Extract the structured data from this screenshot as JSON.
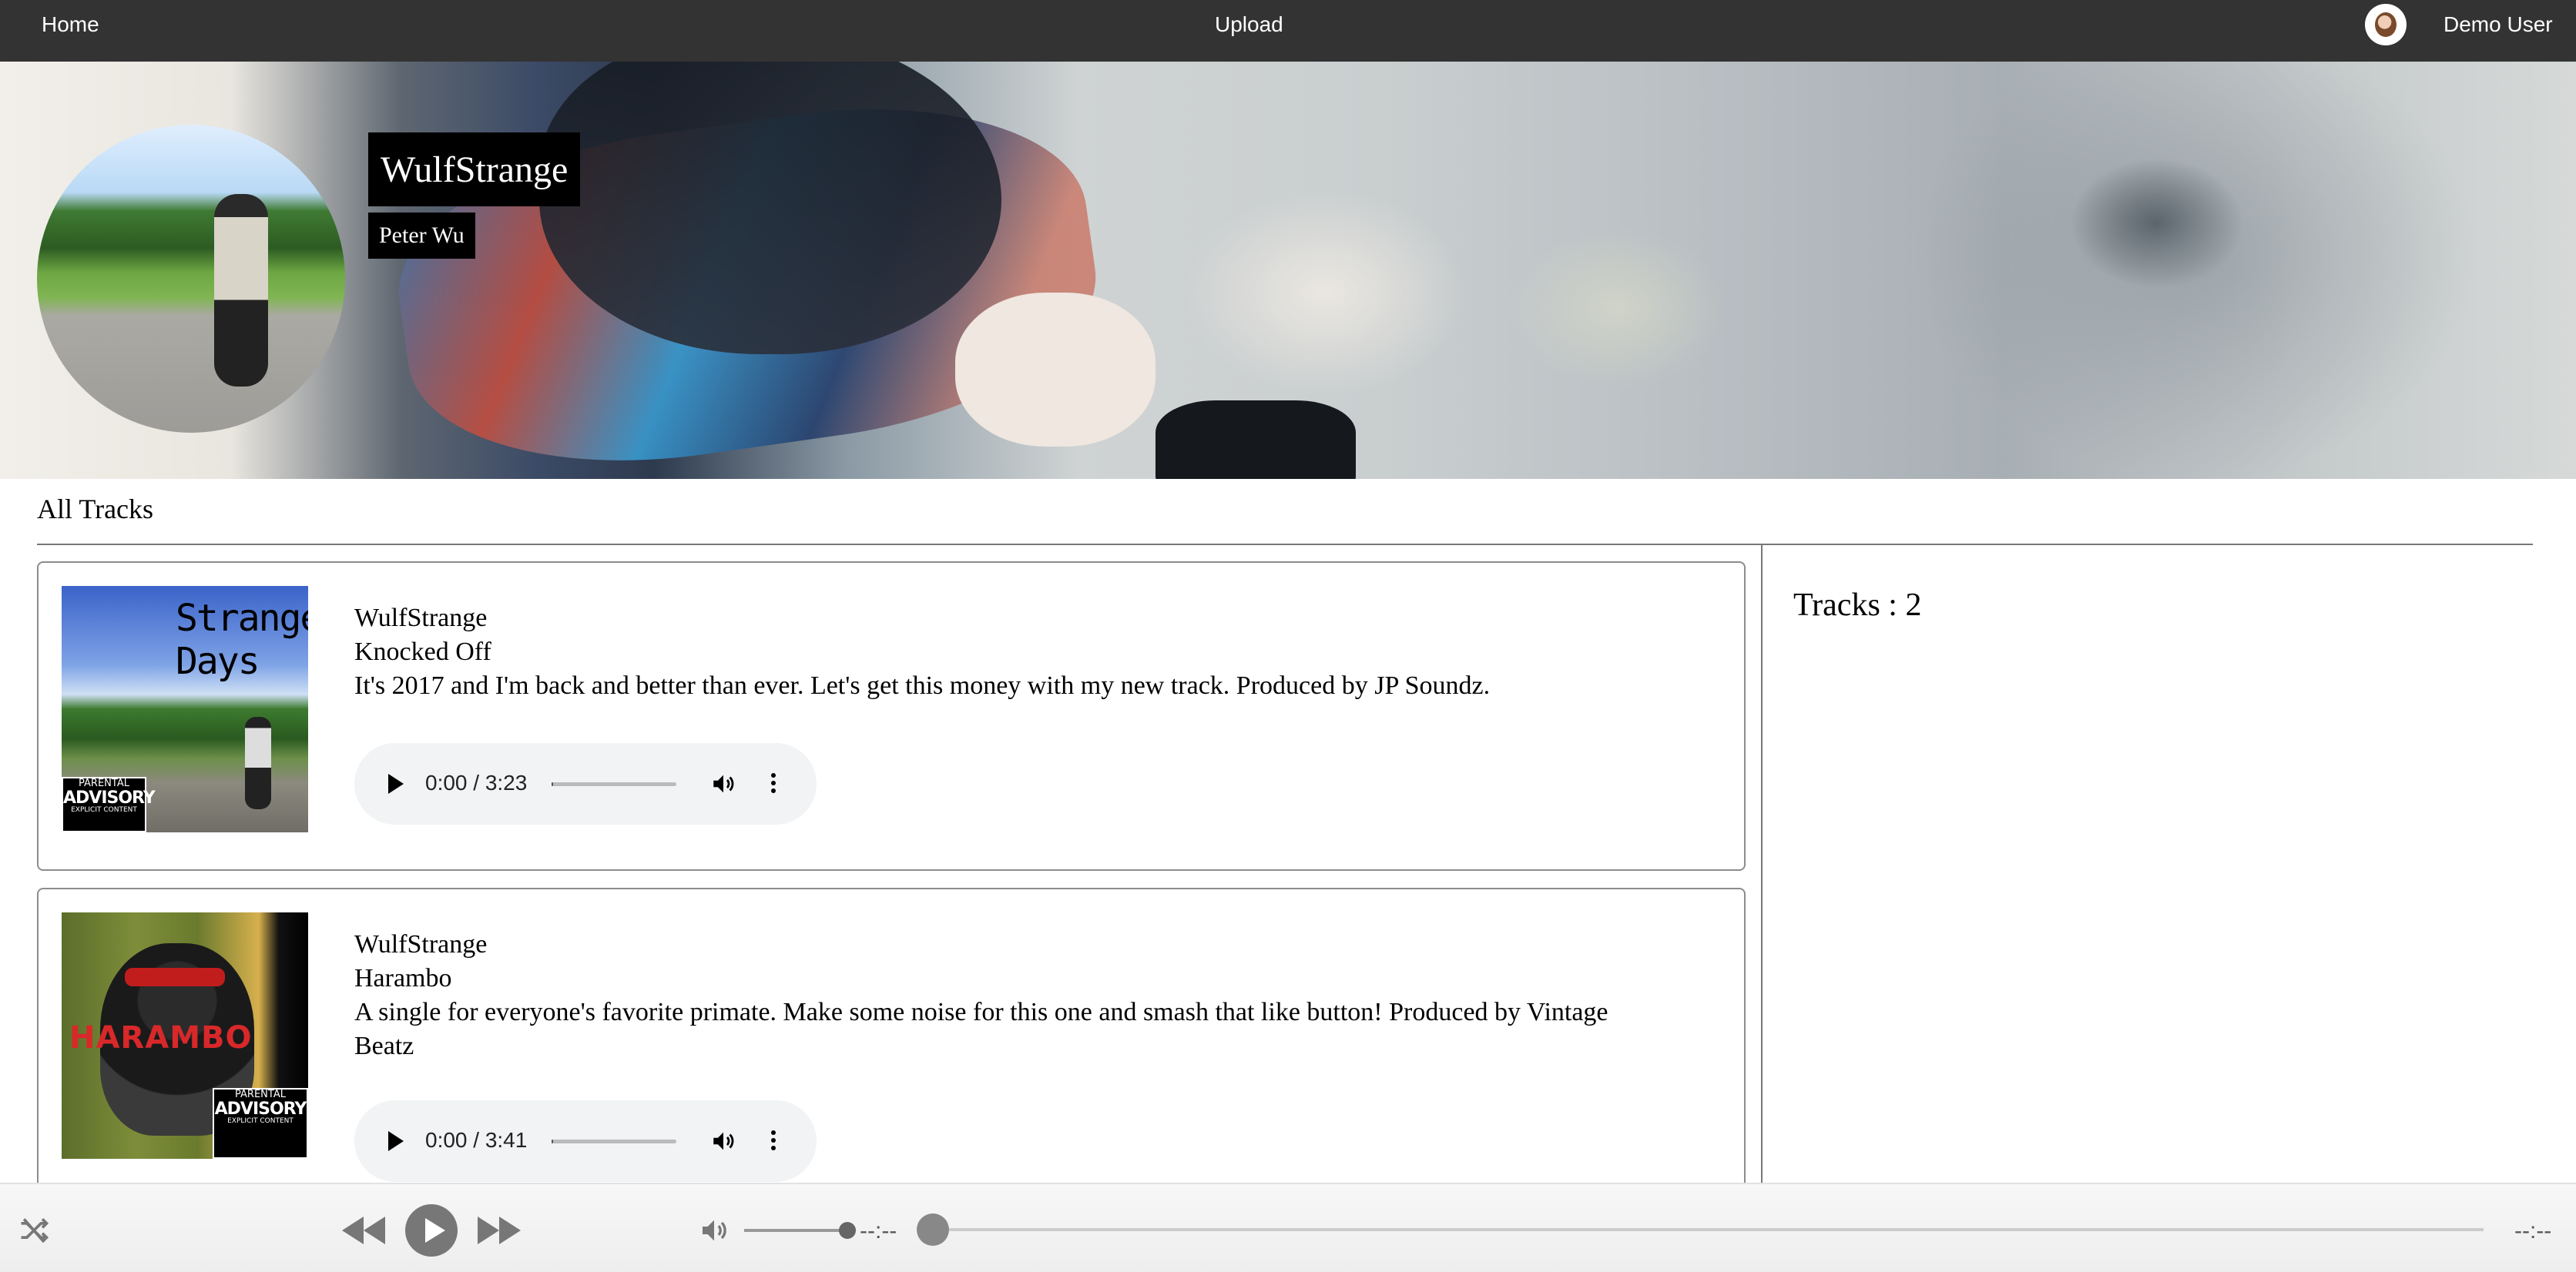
{
  "nav": {
    "home_label": "Home",
    "upload_label": "Upload",
    "user_name": "Demo User"
  },
  "artist": {
    "display_name": "WulfStrange",
    "real_name": "Peter Wu"
  },
  "section_title": "All Tracks",
  "tracks": [
    {
      "artist": "WulfStrange",
      "title": "Knocked Off",
      "description": "It's 2017 and I'm back and better than ever. Let's get this money with my new track. Produced by JP Soundz.",
      "time_display": "0:00 / 3:23",
      "cover_art_text": "Strange Days",
      "advisory_label": [
        "PARENTAL",
        "ADVISORY",
        "EXPLICIT CONTENT"
      ]
    },
    {
      "artist": "WulfStrange",
      "title": "Harambo",
      "description": "A single for everyone's favorite primate. Make some noise for this one and smash that like button! Produced by Vintage Beatz",
      "time_display": "0:00 / 3:41",
      "cover_art_text": "HARAMBO",
      "advisory_label": [
        "PARENTAL",
        "ADVISORY",
        "EXPLICIT CONTENT"
      ]
    }
  ],
  "tracks_count_label": "Tracks : 2",
  "bottom_player": {
    "current_time": "--:--",
    "total_time": "--:--",
    "volume": 0.9,
    "progress": 0
  },
  "icons": {
    "shuffle": "shuffle-icon",
    "previous": "rewind-icon",
    "play": "play-icon",
    "next": "fast-forward-icon",
    "volume": "volume-icon",
    "more": "more-vertical-icon"
  },
  "colors": {
    "nav_background": "#333333",
    "card_border": "#8c8c8c",
    "player_background": "#f1f3f4"
  }
}
